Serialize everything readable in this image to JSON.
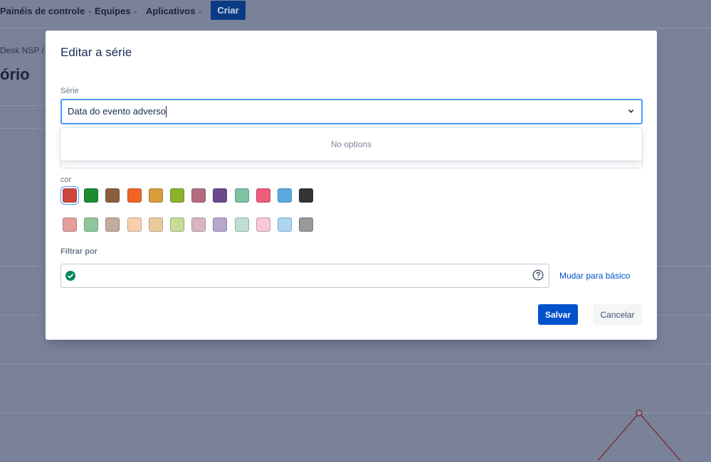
{
  "nav": {
    "items": [
      {
        "label": "Painéis de controle"
      },
      {
        "label": "Equipes"
      },
      {
        "label": "Aplicativos"
      }
    ],
    "create_label": "Criar"
  },
  "background": {
    "breadcrumb": "Desk NSP  /",
    "title_fragment": "ório"
  },
  "modal": {
    "title": "Editar a série",
    "series_label": "Série",
    "series_value": "Data do evento adverso",
    "no_options": "No options",
    "color_label": "cor",
    "colors_row1": [
      "#d0453b",
      "#1e8a2f",
      "#8b5e3c",
      "#ef6526",
      "#d99c3a",
      "#8db22c",
      "#b26d7d",
      "#6a4a8c",
      "#7ec2a2",
      "#ef5b7a",
      "#5ba9df",
      "#333333"
    ],
    "colors_row2": [
      "#e5a09a",
      "#8fc79b",
      "#c3ac9c",
      "#f7d0ab",
      "#e9cb9b",
      "#c9db97",
      "#d9b6bf",
      "#b7a7cc",
      "#bfe0d0",
      "#f8c9d5",
      "#add6ef",
      "#999999"
    ],
    "selected_color_index": 0,
    "filter_label": "Filtrar por",
    "filter_value": "",
    "switch_basic_label": "Mudar para básico",
    "save_label": "Salvar",
    "cancel_label": "Cancelar"
  }
}
